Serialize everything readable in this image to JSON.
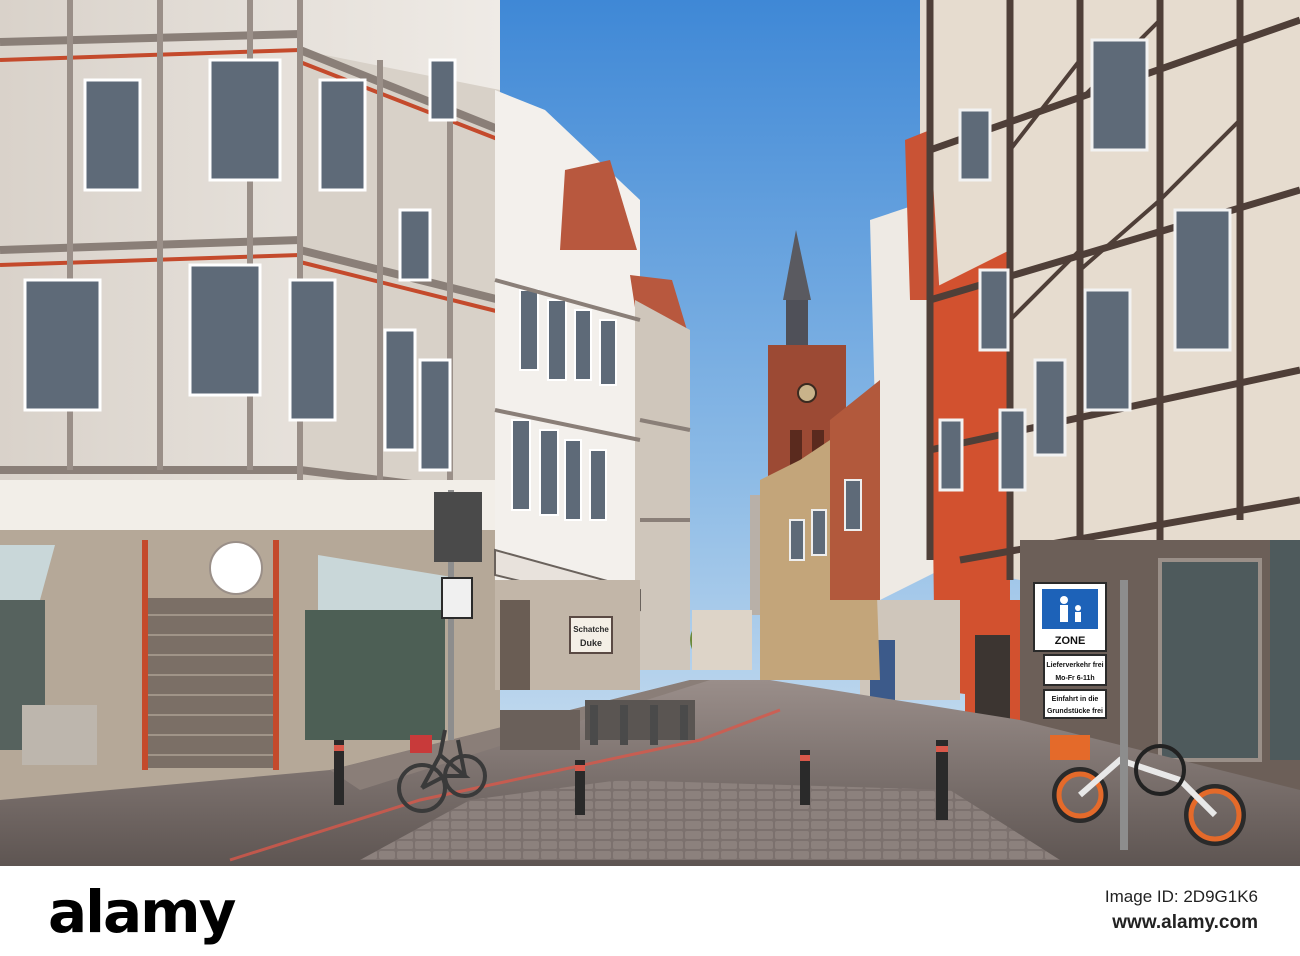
{
  "photo": {
    "signs": {
      "zone": "ZONE",
      "delivery_line1": "Lieferverkehr frei",
      "delivery_line2": "Mo-Fr  6-11h",
      "entry_line1": "Einfahrt in die",
      "entry_line2": "Grundstücke frei",
      "shop_sign": "Schatche Duke"
    },
    "colors": {
      "sky_top": "#4a8fd8",
      "sky_bottom": "#d6e6f3",
      "street": "#7b6f6b",
      "timber": "#5a4a44",
      "red_plaster": "#d2512f",
      "church_brick": "#9c4a34"
    }
  },
  "watermark": {
    "logo": "alamy",
    "id_label": "Image ID: 2D9G1K6",
    "url": "www.alamy.com"
  }
}
